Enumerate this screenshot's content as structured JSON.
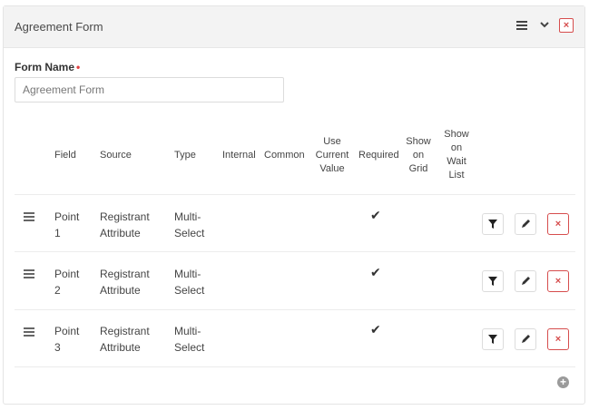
{
  "panel": {
    "title": "Agreement Form",
    "menu_icon": "hamburger-icon",
    "collapse_icon": "chevron-down-icon",
    "close_icon": "close-icon",
    "close_glyph": "×"
  },
  "form": {
    "name_label": "Form Name",
    "required_marker": "•",
    "name_value": "Agreement Form"
  },
  "table": {
    "headers": {
      "field": "Field",
      "source": "Source",
      "type": "Type",
      "internal": "Internal",
      "common": "Common",
      "use_current_value": [
        "Use",
        "Current",
        "Value"
      ],
      "required": "Required",
      "show_on_grid": [
        "Show",
        "on",
        "Grid"
      ],
      "show_on_wait_list": [
        "Show",
        "on",
        "Wait",
        "List"
      ]
    },
    "rows": [
      {
        "field": [
          "Point",
          "1"
        ],
        "source": [
          "Registrant",
          "Attribute"
        ],
        "type": [
          "Multi-",
          "Select"
        ],
        "required": true
      },
      {
        "field": [
          "Point",
          "2"
        ],
        "source": [
          "Registrant",
          "Attribute"
        ],
        "type": [
          "Multi-",
          "Select"
        ],
        "required": true
      },
      {
        "field": [
          "Point",
          "3"
        ],
        "source": [
          "Registrant",
          "Attribute"
        ],
        "type": [
          "Multi-",
          "Select"
        ],
        "required": true
      }
    ],
    "check_glyph": "✔",
    "delete_glyph": "×",
    "add_glyph": "+"
  },
  "colors": {
    "header_bg": "#f3f3f3",
    "danger": "#d64d4d",
    "required_marker": "#e23f3f"
  }
}
